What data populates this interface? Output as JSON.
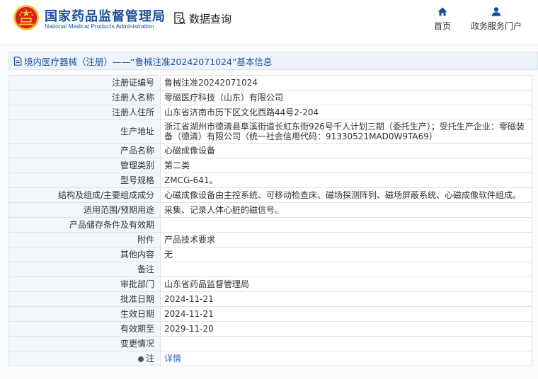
{
  "header": {
    "site_name_cn": "国家药品监督管理局",
    "site_name_en": "National Medical Products Administration",
    "query_label": "数据查询",
    "nav_home": "首页",
    "nav_portal": "政务服务门户"
  },
  "breadcrumb": {
    "text": "境内医疗器械（注册）——“鲁械注准20242071024”基本信息"
  },
  "rows": [
    {
      "label": "注册证编号",
      "value": "鲁械注准20242071024"
    },
    {
      "label": "注册人名称",
      "value": "零磁医疗科技（山东）有限公司"
    },
    {
      "label": "注册人住所",
      "value": "山东省济南市历下区文化西路44号2-204"
    },
    {
      "label": "生产地址",
      "value": "浙江省湖州市德清县阜溪街道长虹东街926号千人计划三期（委托生产）；受托生产企业：零磁装备（德清）有限公司（统一社会信用代码：91330521MAD0W9TA69）"
    },
    {
      "label": "产品名称",
      "value": "心磁成像设备"
    },
    {
      "label": "管理类别",
      "value": "第二类"
    },
    {
      "label": "型号规格",
      "value": "ZMCG-641。"
    },
    {
      "label": "结构及组成/主要组成成分",
      "value": "心磁成像设备由主控系统、可移动检查床、磁场探测阵列、磁场屏蔽系统、心磁成像软件组成。"
    },
    {
      "label": "适用范围/预期用途",
      "value": "采集、记录人体心脏的磁信号。"
    },
    {
      "label": "产品储存条件及有效期",
      "value": ""
    },
    {
      "label": "附件",
      "value": "产品技术要求"
    },
    {
      "label": "其他内容",
      "value": "无"
    },
    {
      "label": "备注",
      "value": ""
    },
    {
      "label": "审批部门",
      "value": "山东省药品监督管理局"
    },
    {
      "label": "批准日期",
      "value": "2024-11-21"
    },
    {
      "label": "生效日期",
      "value": "2024-11-21"
    },
    {
      "label": "有效期至",
      "value": "2029-11-20"
    },
    {
      "label": "变更情况",
      "value": ""
    }
  ],
  "note_row": {
    "label": "注",
    "link": "详情"
  },
  "colors": {
    "brand_blue": "#1a4f9c",
    "emblem_red": "#d7201f",
    "emblem_gold": "#f4c430"
  }
}
